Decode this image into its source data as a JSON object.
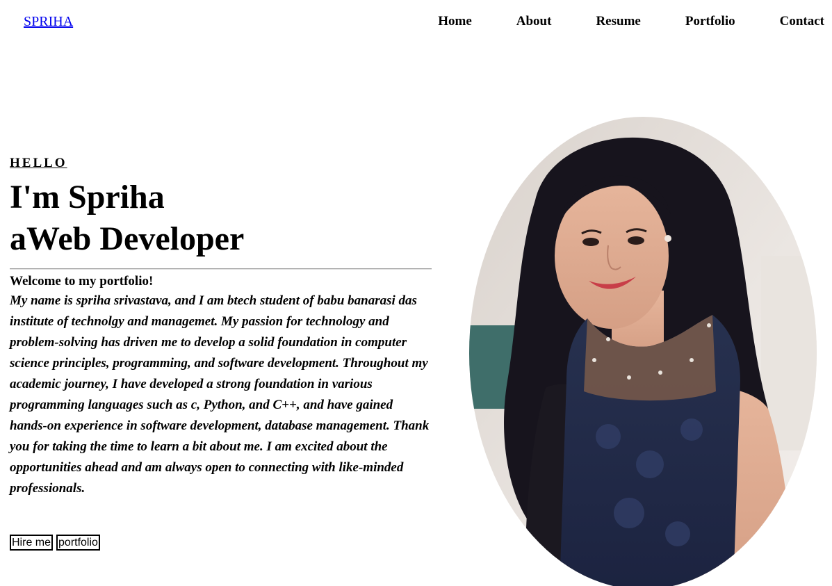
{
  "header": {
    "logo": "SPRIHA",
    "nav": [
      "Home",
      "About",
      "Resume",
      "Portfolio",
      "Contact"
    ]
  },
  "hero": {
    "greeting": "HELLO",
    "title_line1": "I'm Spriha",
    "title_line2": "aWeb Developer",
    "welcome": "Welcome to my portfolio!",
    "bio": "My name is spriha srivastava, and I am btech student of babu banarasi das institute of technolgy and managemet. My passion for technology and problem-solving has driven me to develop a solid foundation in computer science principles, programming, and software development. Throughout my academic journey, I have developed a strong foundation in various programming languages such as c, Python, and C++, and have gained hands-on experience in software development, database management. Thank you for taking the time to learn a bit about me. I am excited about the opportunities ahead and am always open to connecting with like-minded professionals."
  },
  "actions": {
    "hire_label": "Hire me",
    "portfolio_label": "portfolio"
  },
  "colors": {
    "link": "#0000ee",
    "text": "#000000",
    "background": "#ffffff"
  }
}
